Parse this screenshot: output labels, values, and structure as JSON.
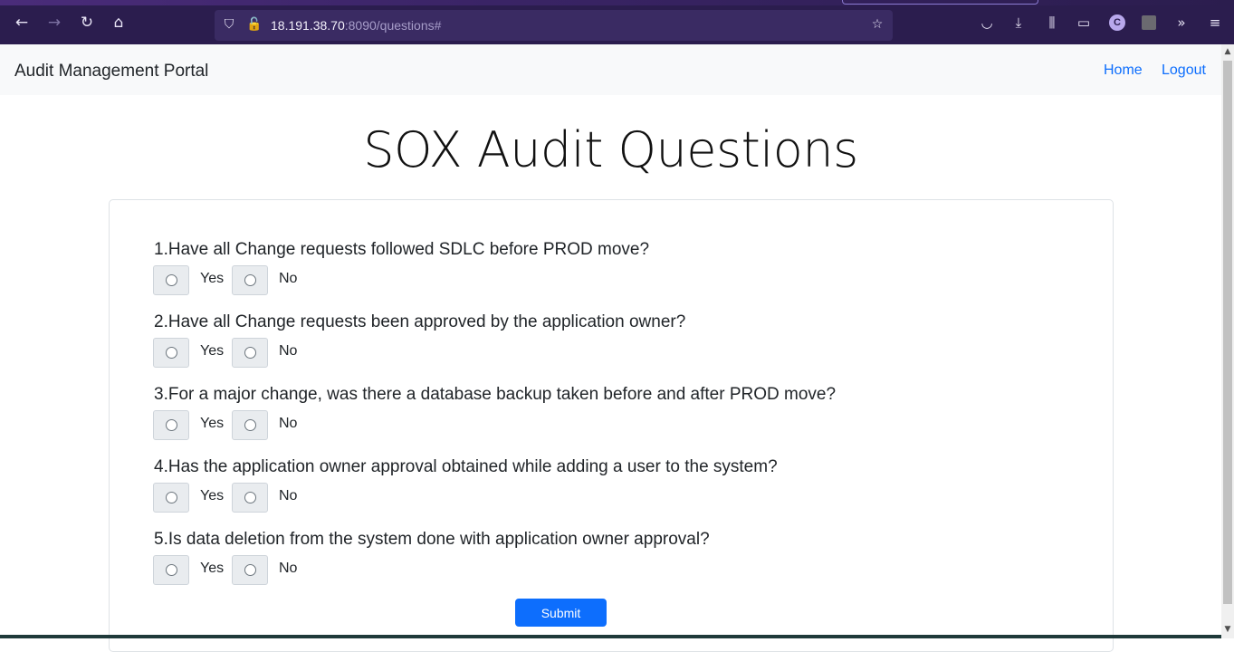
{
  "browser": {
    "url_host": "18.191.38.70",
    "url_rest": ":8090/questions#",
    "profile_initial": "C",
    "icons": {
      "back": "back-arrow-icon",
      "forward": "forward-arrow-icon",
      "reload": "reload-icon",
      "home": "home-icon",
      "shield": "shield-icon",
      "lock": "lock-icon",
      "star": "star-icon",
      "pocket": "pocket-icon",
      "download": "download-icon",
      "library": "library-icon",
      "sidebar": "sidebar-icon",
      "overflow": "chevron-double-right-icon",
      "menu": "hamburger-menu-icon"
    }
  },
  "navbar": {
    "brand": "Audit Management Portal",
    "links": [
      "Home",
      "Logout"
    ]
  },
  "main": {
    "title": "SOX Audit Questions",
    "questions": [
      "1.Have all Change requests followed SDLC before PROD move?",
      "2.Have all Change requests been approved by the application owner?",
      "3.For a major change, was there a database backup taken before and after PROD move?",
      "4.Has the application owner approval obtained while adding a user to the system?",
      "5.Is data deletion from the system done with application owner approval?"
    ],
    "options": [
      "Yes",
      "No"
    ],
    "submit_label": "Submit"
  },
  "colors": {
    "browser_chrome": "#2b1d4e",
    "navbar_bg": "#f8f9fa",
    "link": "#0d6efd",
    "primary_button": "#0d6efd"
  }
}
